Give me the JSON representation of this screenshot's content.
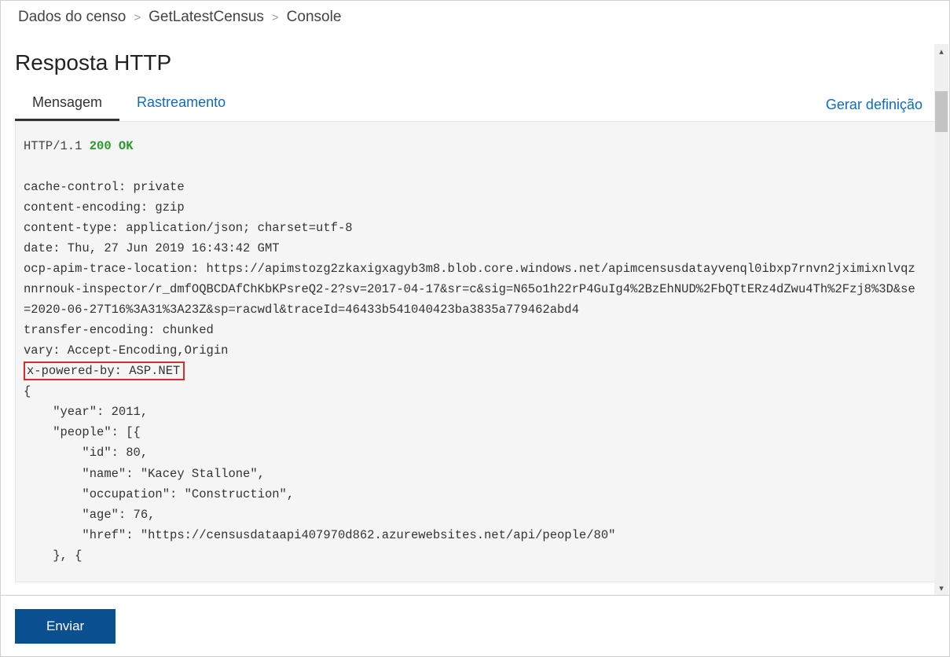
{
  "breadcrumb": {
    "items": [
      "Dados do censo",
      "GetLatestCensus",
      "Console"
    ]
  },
  "page": {
    "title": "Resposta HTTP"
  },
  "tabs": {
    "message": "Mensagem",
    "trace": "Rastreamento",
    "generate": "Gerar definição"
  },
  "response": {
    "proto": "HTTP/1.1 ",
    "status": "200 OK",
    "headers": [
      "cache-control: private",
      "content-encoding: gzip",
      "content-type: application/json; charset=utf-8",
      "date: Thu, 27 Jun 2019 16:43:42 GMT",
      "ocp-apim-trace-location: https://apimstozg2zkaxigxagyb3m8.blob.core.windows.net/apimcensusdatayvenql0ibxp7rnvn2jximixnlvqznnrnouk-inspector/r_dmfOQBCDAfChKbKPsreQ2-2?sv=2017-04-17&sr=c&sig=N65o1h22rP4GuIg4%2BzEhNUD%2FbQTtERz4dZwu4Th%2Fzj8%3D&se=2020-06-27T16%3A31%3A23Z&sp=racwdl&traceId=46433b541040423ba3835a779462abd4",
      "transfer-encoding: chunked",
      "vary: Accept-Encoding,Origin"
    ],
    "highlighted_header": "x-powered-by: ASP.NET",
    "body_lines": [
      "{",
      "    \"year\": 2011,",
      "    \"people\": [{",
      "        \"id\": 80,",
      "        \"name\": \"Kacey Stallone\",",
      "        \"occupation\": \"Construction\",",
      "        \"age\": 76,",
      "        \"href\": \"https://censusdataapi407970d862.azurewebsites.net/api/people/80\"",
      "    }, {"
    ]
  },
  "footer": {
    "send": "Enviar"
  }
}
